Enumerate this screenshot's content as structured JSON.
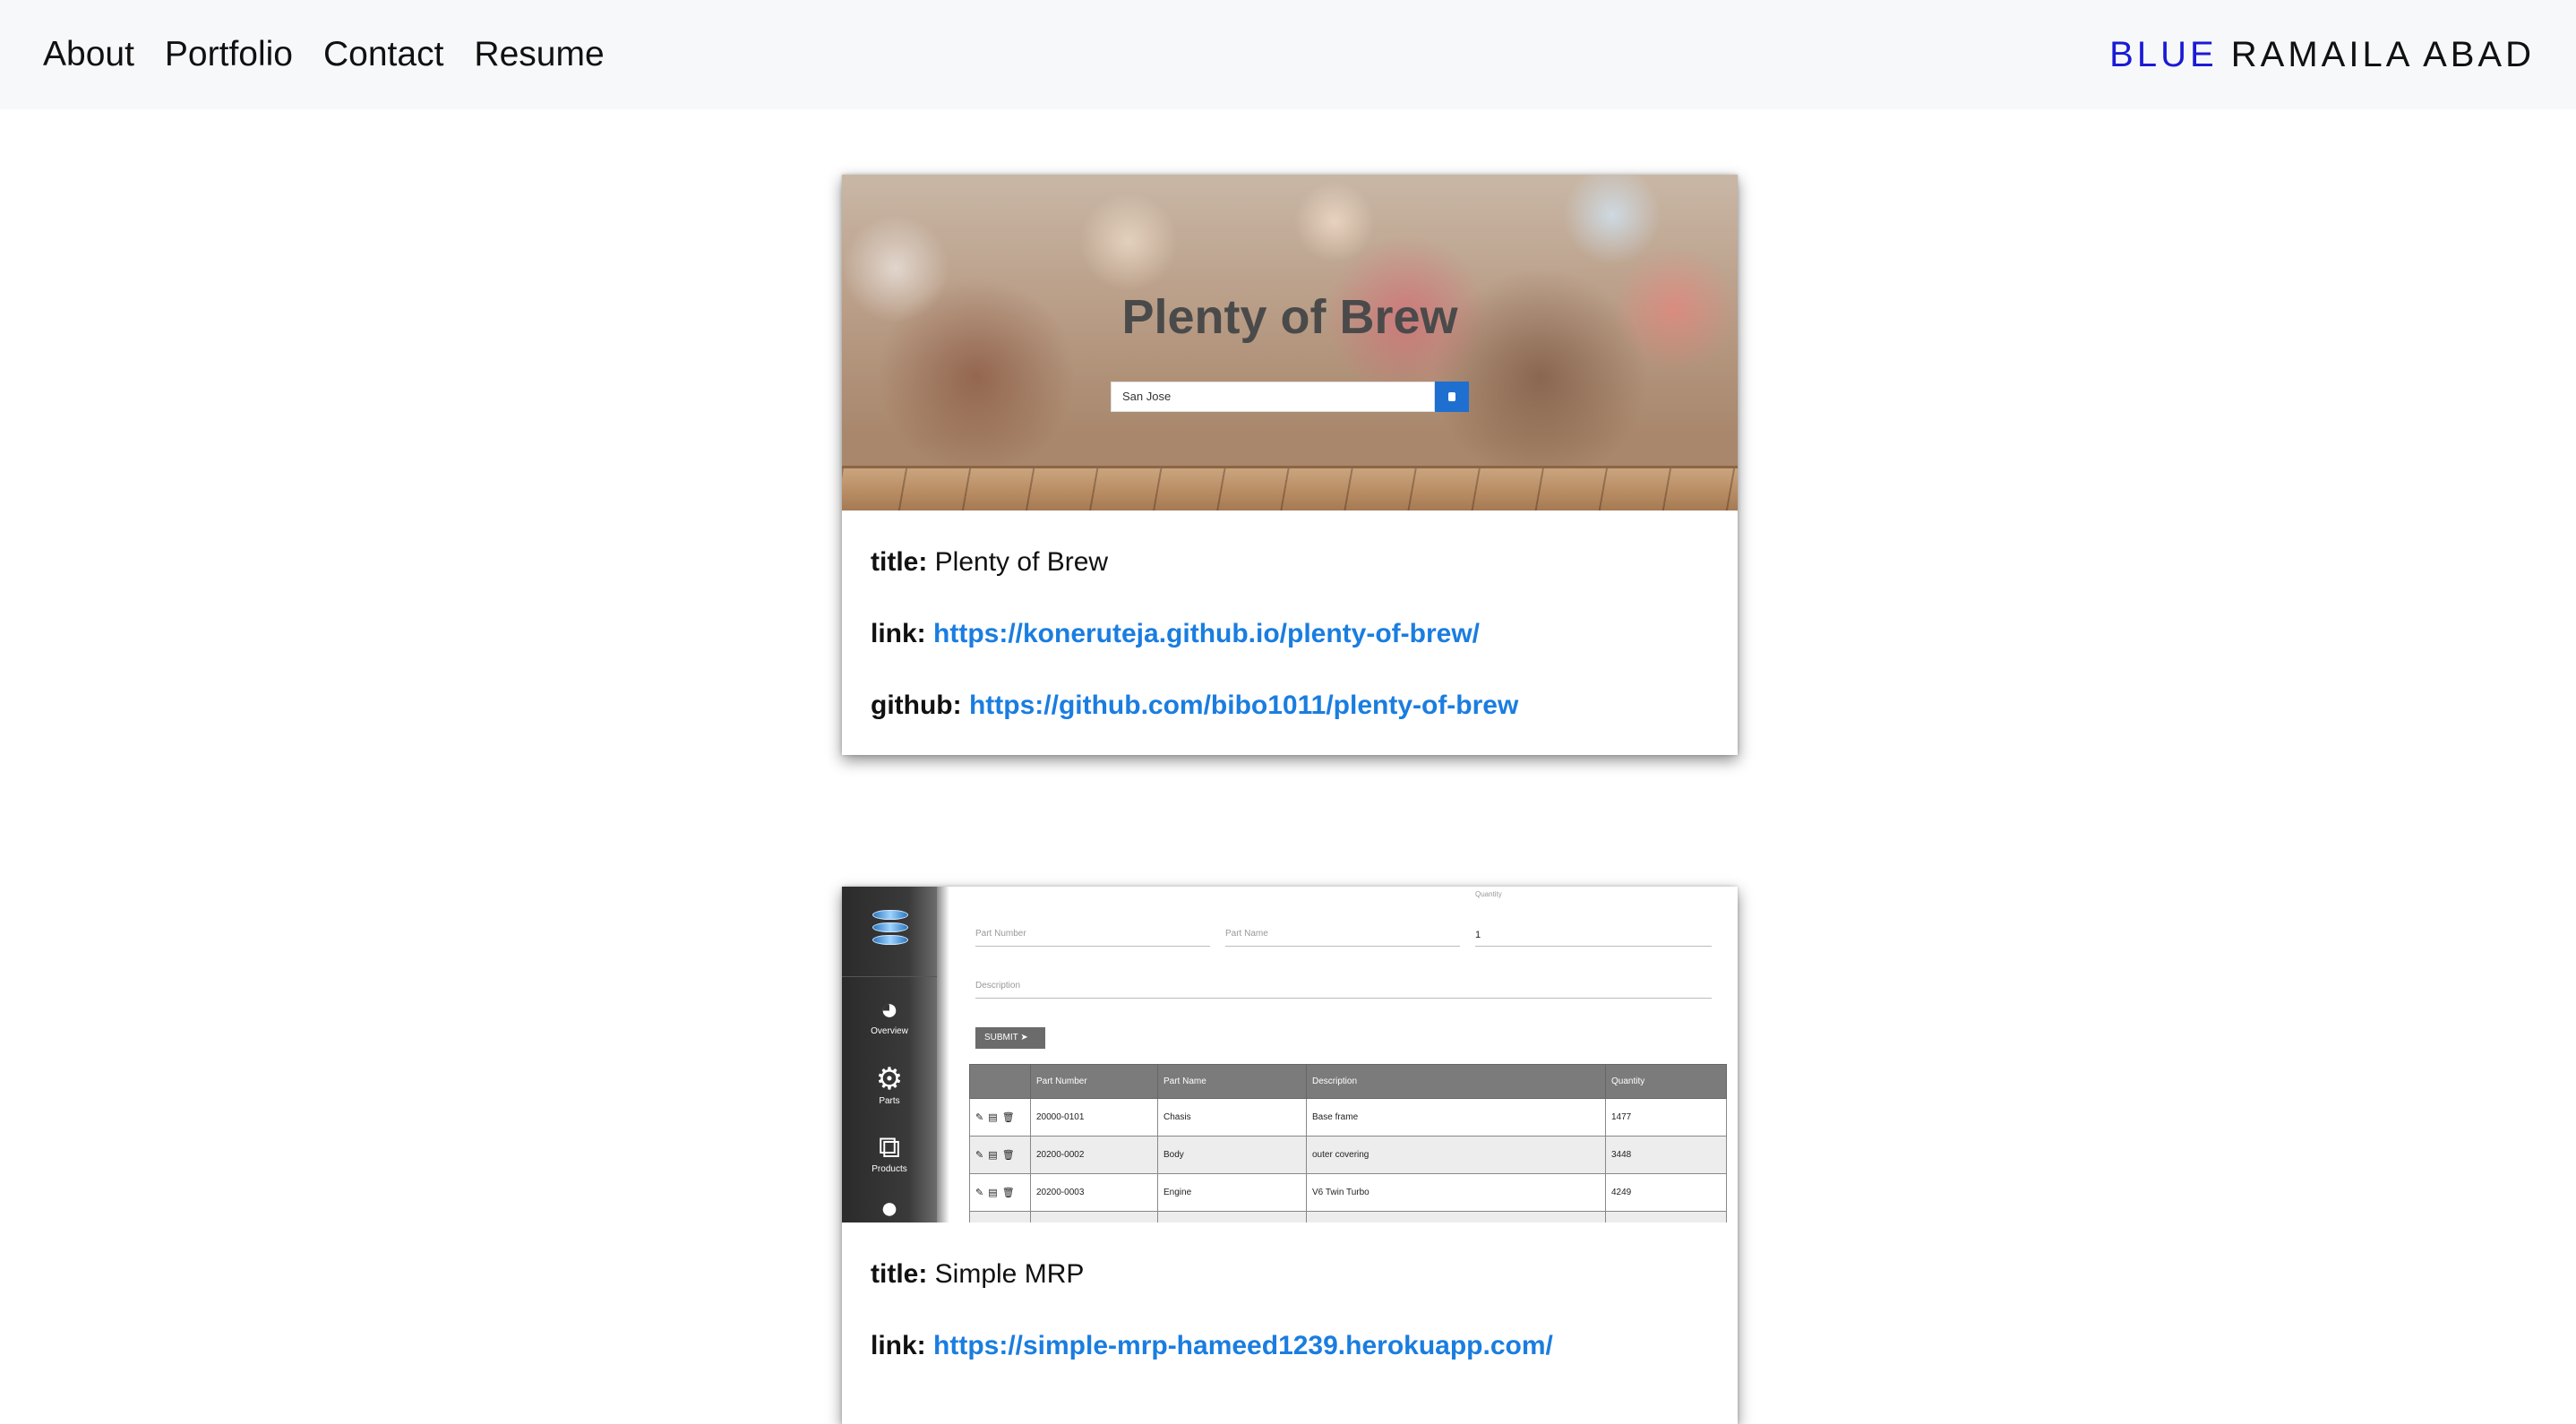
{
  "nav": {
    "links": [
      "About",
      "Portfolio",
      "Contact",
      "Resume"
    ],
    "brand_first": "BLUE",
    "brand_rest": "RAMAILA ABAD"
  },
  "colors": {
    "brand_accent": "#1a1ad6",
    "link": "#1a7de0",
    "nav_bg": "#f7f8f9"
  },
  "projects": [
    {
      "title_key": "title:",
      "title": "Plenty of Brew",
      "link_key": "link:",
      "link": "https://koneruteja.github.io/plenty-of-brew/",
      "github_key": "github:",
      "github": "https://github.com/bibo1011/plenty-of-brew",
      "screenshot": {
        "heading": "Plenty of Brew",
        "search_value": "San Jose"
      }
    },
    {
      "title_key": "title:",
      "title": "Simple MRP",
      "link_key": "link:",
      "link": "https://simple-mrp-hameed1239.herokuapp.com/",
      "screenshot": {
        "sidebar": [
          "Overview",
          "Parts",
          "Products"
        ],
        "fields": {
          "part_number": "Part Number",
          "part_name": "Part Name",
          "quantity_label": "Quantity",
          "quantity_value": "1",
          "description": "Description"
        },
        "submit": "SUBMIT ➤",
        "table": {
          "headers": [
            "",
            "Part Number",
            "Part Name",
            "Description",
            "Quantity"
          ],
          "rows": [
            [
              "✎ ▤ 🗑",
              "20000-0101",
              "Chasis",
              "Base frame",
              "1477"
            ],
            [
              "✎ ▤ 🗑",
              "20200-0002",
              "Body",
              "outer covering",
              "3448"
            ],
            [
              "✎ ▤ 🗑",
              "20200-0003",
              "Engine",
              "V6 Twin Turbo",
              "4249"
            ]
          ]
        }
      }
    }
  ]
}
